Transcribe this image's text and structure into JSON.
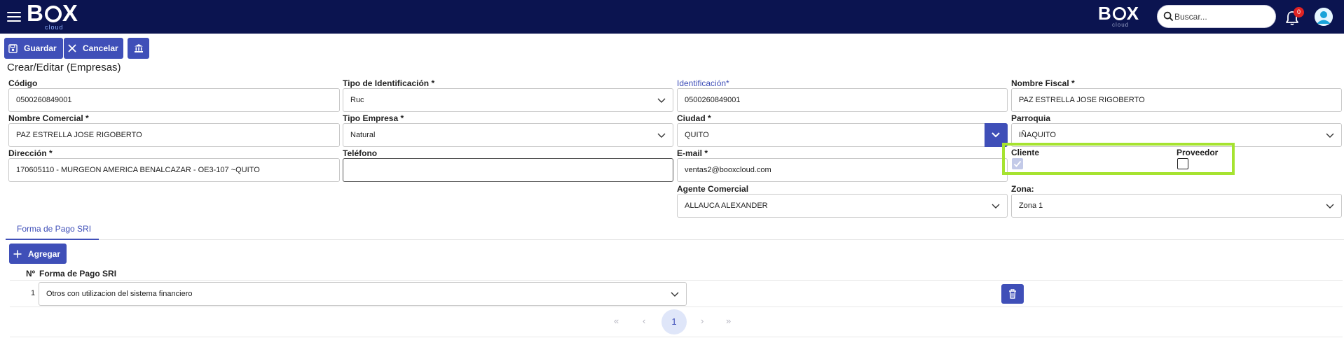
{
  "topbar": {
    "logo_left": {
      "b": "B",
      "x": "X",
      "sub": "cloud"
    },
    "logo_right": {
      "b": "B",
      "x": "X",
      "sub": "cloud"
    },
    "search_placeholder": "Buscar...",
    "notifications_count": "0"
  },
  "toolbar": {
    "save_label": "Guardar",
    "cancel_label": "Cancelar"
  },
  "page_title": "Crear/Editar (Empresas)",
  "form": {
    "codigo": {
      "label": "Código",
      "value": "0500260849001"
    },
    "tipo_identificacion": {
      "label": "Tipo de Identificación",
      "value": "Ruc"
    },
    "identificacion": {
      "label": "Identificación*",
      "value": "0500260849001"
    },
    "nombre_fiscal": {
      "label": "Nombre Fiscal",
      "value": "PAZ ESTRELLA JOSE RIGOBERTO"
    },
    "nombre_comercial": {
      "label": "Nombre Comercial",
      "value": "PAZ ESTRELLA JOSE RIGOBERTO"
    },
    "tipo_empresa": {
      "label": "Tipo Empresa",
      "value": "Natural"
    },
    "ciudad": {
      "label": "Ciudad",
      "value": "QUITO"
    },
    "parroquia": {
      "label": "Parroquia",
      "value": "IÑAQUITO"
    },
    "direccion": {
      "label": "Dirección",
      "value": "170605110 - MURGEON AMERICA BENALCAZAR - OE3-107   ~QUITO"
    },
    "telefono": {
      "label": "Teléfono",
      "value": ""
    },
    "email": {
      "label": "E-mail",
      "value": "ventas2@booxcloud.com"
    },
    "cliente": {
      "label": "Cliente",
      "checked": true
    },
    "proveedor": {
      "label": "Proveedor",
      "checked": false
    },
    "agente_comercial": {
      "label": "Agente Comercial",
      "value": "ALLAUCA ALEXANDER"
    },
    "zona": {
      "label": "Zona:",
      "value": "Zona 1"
    },
    "required_mark": "*"
  },
  "tabs": [
    {
      "label": "Forma de Pago SRI",
      "active": true
    }
  ],
  "grid": {
    "add_label": "Agregar",
    "columns": [
      "Nº",
      "Forma de Pago SRI"
    ],
    "rows": [
      {
        "num": "1",
        "forma_pago": "Otros con utilizacion del sistema financiero"
      }
    ],
    "pager": {
      "first": "«",
      "prev": "‹",
      "current": "1",
      "next": "›",
      "last": "»"
    }
  },
  "colors": {
    "topbar": "#0b1450",
    "accent": "#3f4fb8",
    "highlight": "#a6e330",
    "badge": "#e02323"
  }
}
